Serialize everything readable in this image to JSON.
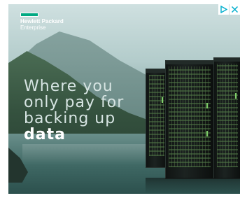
{
  "ad": {
    "brand_line1": "Hewlett Packard",
    "brand_line2": "Enterprise",
    "headline": {
      "line1": "Where you",
      "line2": "only pay for",
      "line3": "backing up",
      "line4": "data"
    },
    "colors": {
      "brand_green": "#01a982",
      "adchoices_blue": "#00aecd"
    }
  },
  "icons": {
    "adchoices": "adchoices-icon",
    "close": "close-icon"
  }
}
